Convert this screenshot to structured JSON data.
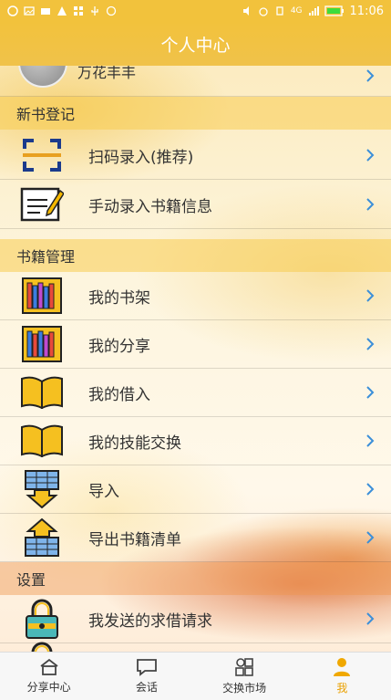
{
  "status_bar": {
    "time": "11:06",
    "network": "4G"
  },
  "header": {
    "title": "个人中心"
  },
  "profile": {
    "name": "万花丰丰"
  },
  "sections": {
    "new_book": {
      "title": "新书登记"
    },
    "book_mgmt": {
      "title": "书籍管理"
    },
    "settings": {
      "title": "设置"
    }
  },
  "items": [
    {
      "label": "扫码录入(推荐)",
      "icon": "scan-icon"
    },
    {
      "label": "手动录入书籍信息",
      "icon": "edit-form-icon"
    },
    {
      "label": "我的书架",
      "icon": "bookshelf-icon"
    },
    {
      "label": "我的分享",
      "icon": "share-books-icon"
    },
    {
      "label": "我的借入",
      "icon": "open-book-icon"
    },
    {
      "label": "我的技能交换",
      "icon": "open-book-icon"
    },
    {
      "label": "导入",
      "icon": "import-icon"
    },
    {
      "label": "导出书籍清单",
      "icon": "export-icon"
    },
    {
      "label": "我发送的求借请求",
      "icon": "lock-icon"
    }
  ],
  "tabs": [
    {
      "label": "分享中心",
      "icon": "home-icon"
    },
    {
      "label": "会话",
      "icon": "chat-icon"
    },
    {
      "label": "交换市场",
      "icon": "market-icon"
    },
    {
      "label": "我",
      "icon": "user-icon"
    }
  ],
  "colors": {
    "accent": "#f2c23c",
    "active_tab": "#e9a000",
    "chevron": "#3b8fd9"
  }
}
